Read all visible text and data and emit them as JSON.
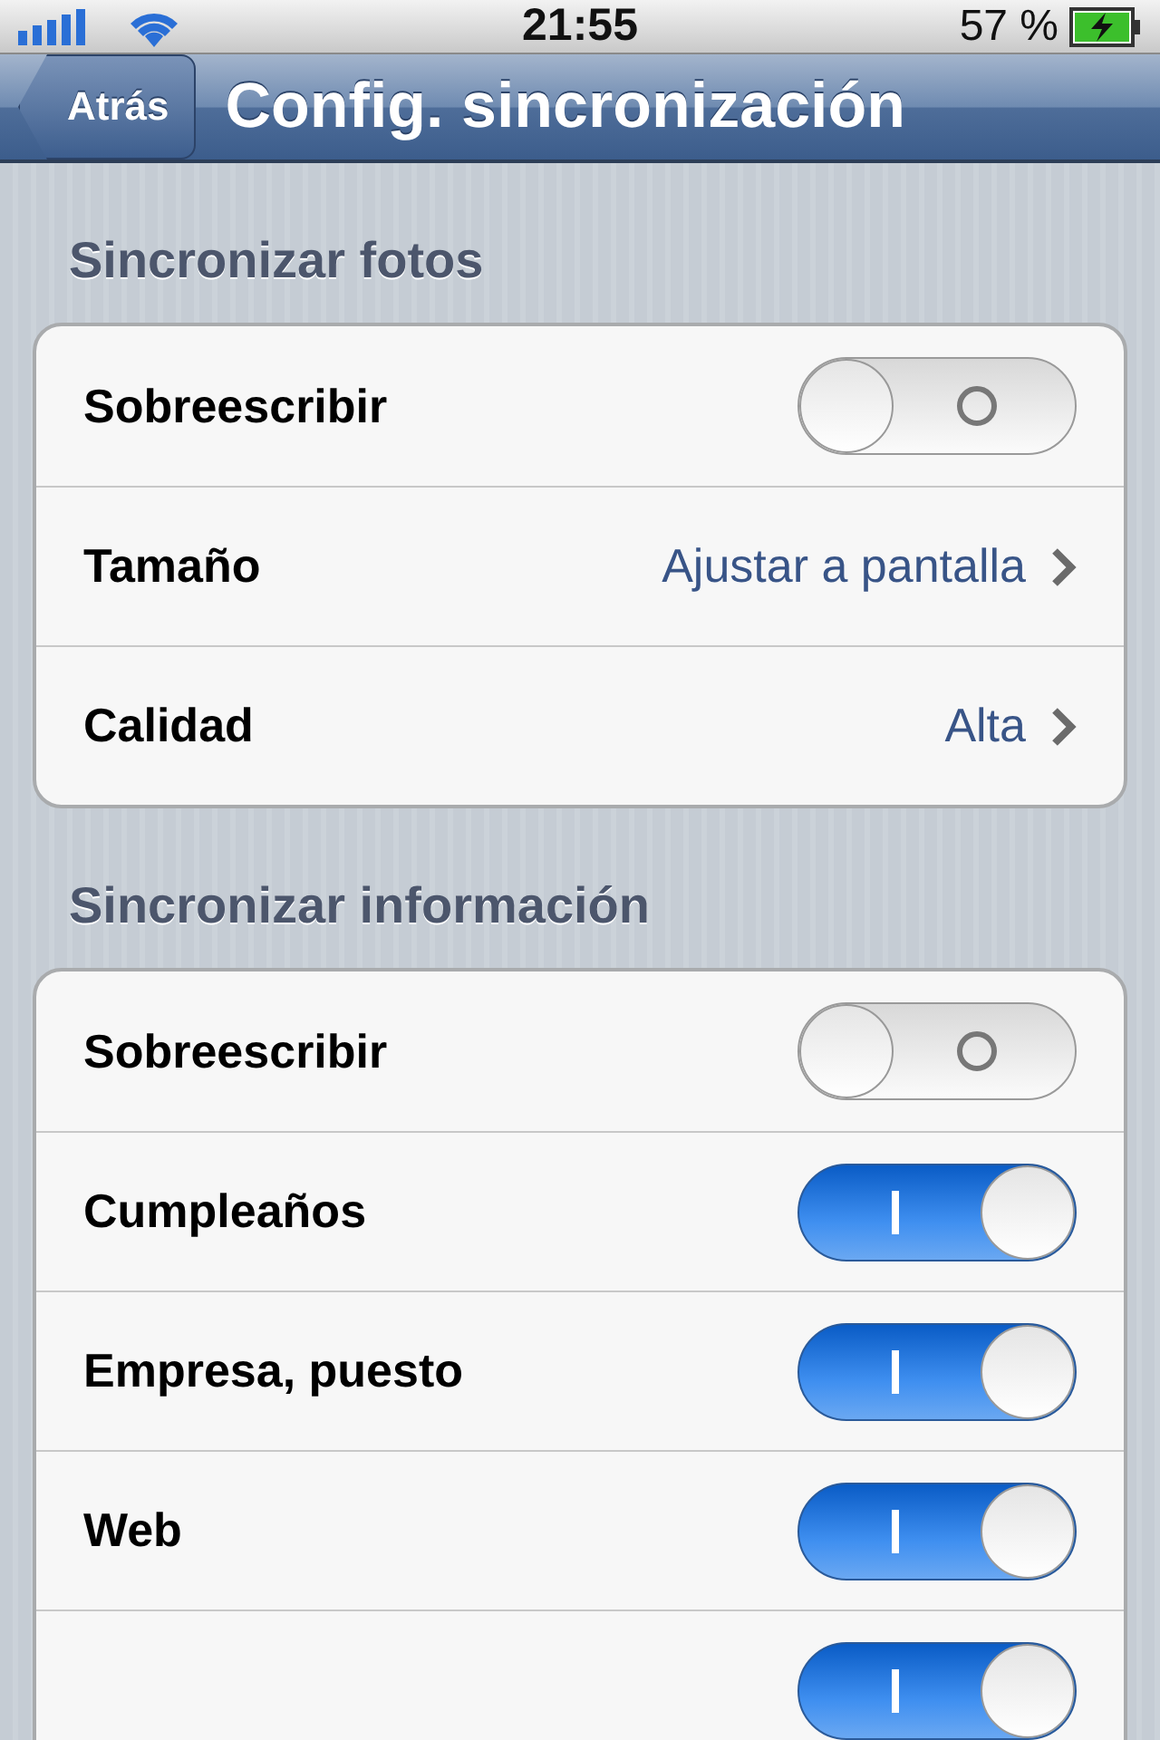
{
  "status_bar": {
    "time": "21:55",
    "battery": "57 %",
    "charging": true
  },
  "nav_bar": {
    "back_button": "Atrás",
    "title": "Config. sincronización"
  },
  "sections": [
    {
      "header": "Sincronizar fotos",
      "rows": [
        {
          "kind": "switch",
          "label": "Sobreescribir",
          "on": false
        },
        {
          "kind": "link",
          "label": "Tamaño",
          "value": "Ajustar a pantalla"
        },
        {
          "kind": "link",
          "label": "Calidad",
          "value": "Alta"
        }
      ]
    },
    {
      "header": "Sincronizar información",
      "rows": [
        {
          "kind": "switch",
          "label": "Sobreescribir",
          "on": false
        },
        {
          "kind": "switch",
          "label": "Cumpleaños",
          "on": true
        },
        {
          "kind": "switch",
          "label": "Empresa, puesto",
          "on": true
        },
        {
          "kind": "switch",
          "label": "Web",
          "on": true
        },
        {
          "kind": "switch",
          "on": true
        }
      ]
    }
  ]
}
